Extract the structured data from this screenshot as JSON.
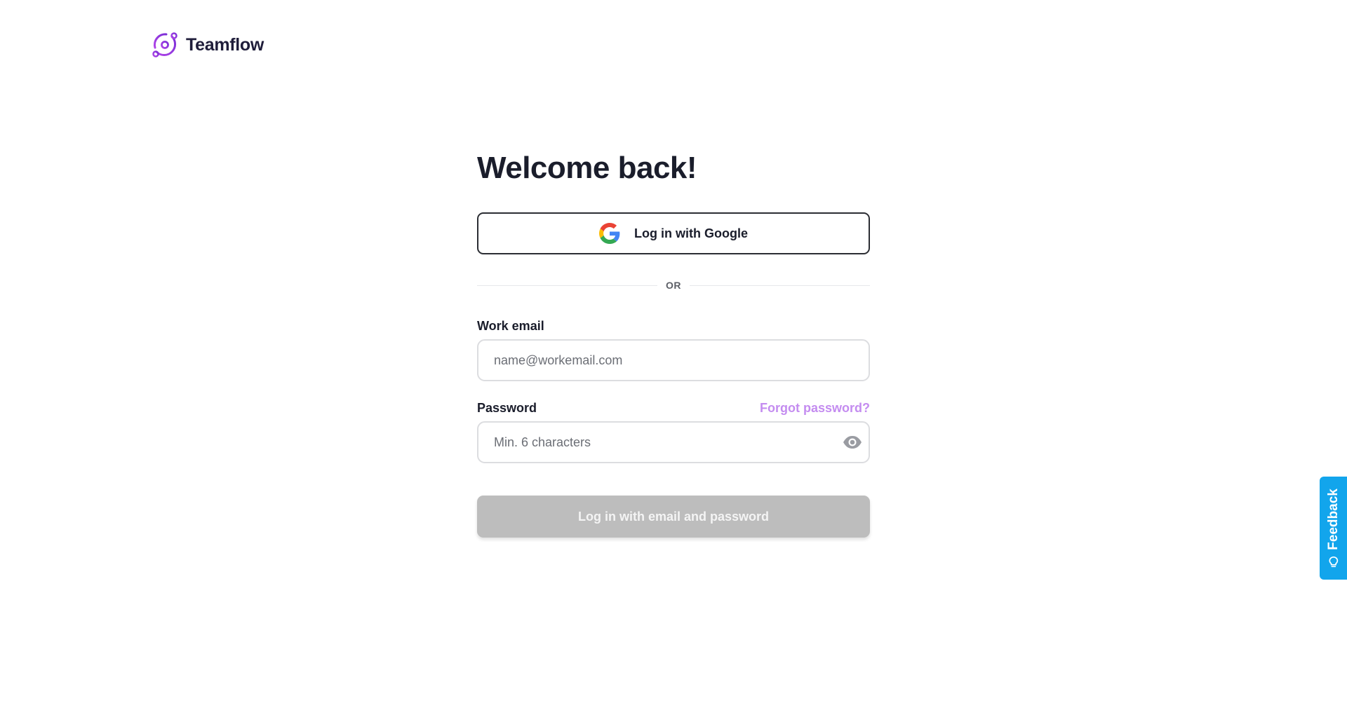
{
  "brand": {
    "name": "Teamflow",
    "logo_icon": "teamflow-orbit-icon",
    "accent": "#9b3de0"
  },
  "login": {
    "title": "Welcome back!",
    "google_button_label": "Log in with Google",
    "divider_text": "OR",
    "email": {
      "label": "Work email",
      "placeholder": "name@workemail.com",
      "value": ""
    },
    "password": {
      "label": "Password",
      "placeholder": "Min. 6 characters",
      "value": "",
      "forgot_link": "Forgot password?",
      "toggle_icon": "eye-icon"
    },
    "submit_label": "Log in with email and password"
  },
  "feedback": {
    "label": "Feedback",
    "icon": "lightbulb-icon",
    "color": "#12a5ec"
  }
}
